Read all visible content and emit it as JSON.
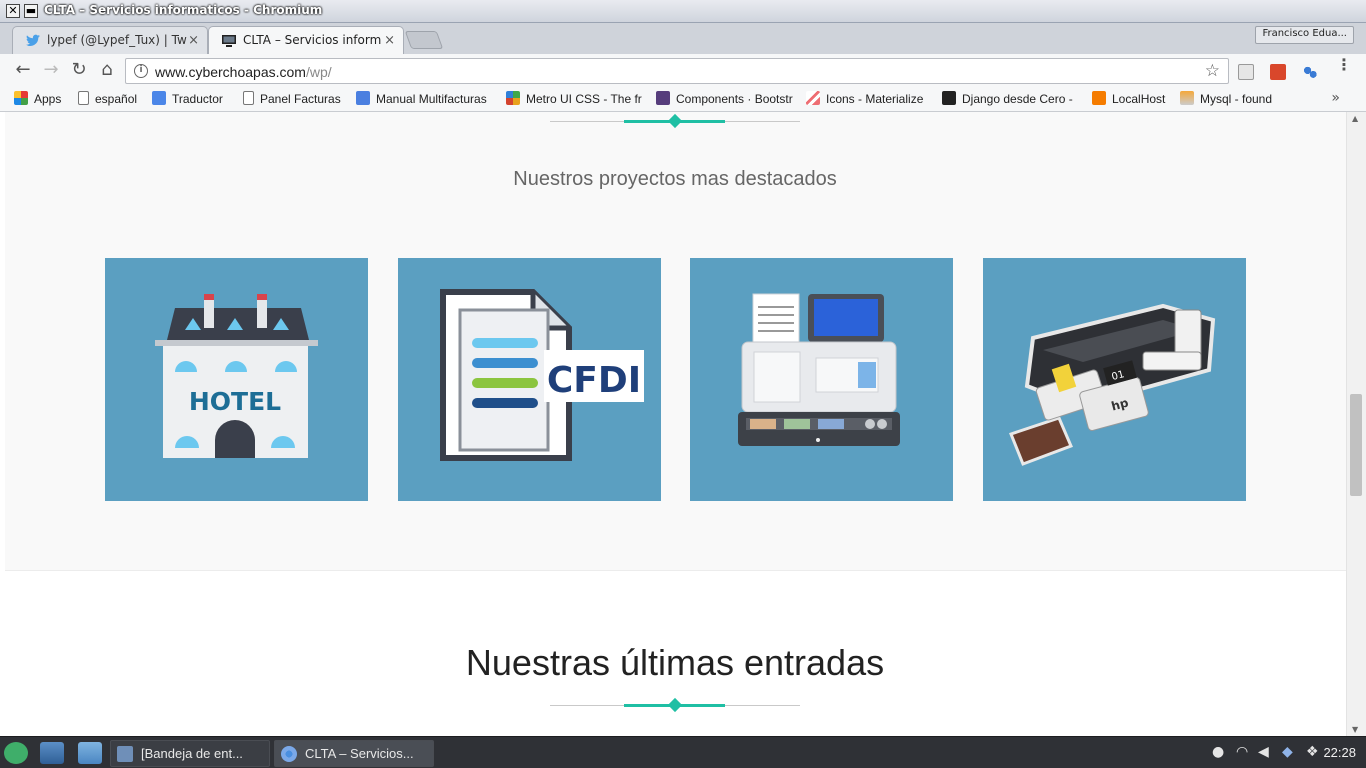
{
  "window": {
    "title": "CLTA – Servicios informaticos - Chromium",
    "close_glyph": "✕",
    "min_glyph": "▬"
  },
  "tabs": [
    {
      "label": "lypef (@Lypef_Tux) | Tw",
      "close": "×"
    },
    {
      "label": "CLTA – Servicios inform",
      "close": "×"
    }
  ],
  "profile": {
    "name": "Francisco Edua..."
  },
  "toolbar": {
    "back": "←",
    "forward": "→",
    "reload": "↻",
    "home": "⌂",
    "star": "☆",
    "menu": "⋮"
  },
  "omnibox": {
    "host": "www.cyberchoapas.com",
    "path": "/wp/",
    "info": "i"
  },
  "bookmarks": [
    {
      "label": "Apps"
    },
    {
      "label": "español"
    },
    {
      "label": "Traductor"
    },
    {
      "label": "Panel Facturas"
    },
    {
      "label": "Manual Multifacturas"
    },
    {
      "label": "Metro UI CSS - The fr"
    },
    {
      "label": "Components · Bootstr"
    },
    {
      "label": "Icons - Materialize"
    },
    {
      "label": "Django desde Cero -"
    },
    {
      "label": "LocalHost"
    },
    {
      "label": "Mysql - found"
    }
  ],
  "bookmarks_overflow": "»",
  "page": {
    "projects_subtitle": "Nuestros proyectos mas destacados",
    "projects": [
      {
        "name": "hotel",
        "sign": "HOTEL"
      },
      {
        "name": "cfdi",
        "sign": "CFDI"
      },
      {
        "name": "cash-register"
      },
      {
        "name": "printer-cartridges",
        "labels": [
          "hp",
          "01"
        ]
      }
    ],
    "latest_title": "Nuestras últimas entradas",
    "accent_color": "#1fbfa4",
    "card_color": "#5b9fc1"
  },
  "taskbar": {
    "tasks": [
      {
        "label": "[Bandeja de ent..."
      },
      {
        "label": "CLTA – Servicios..."
      }
    ],
    "clock": "22:28"
  }
}
